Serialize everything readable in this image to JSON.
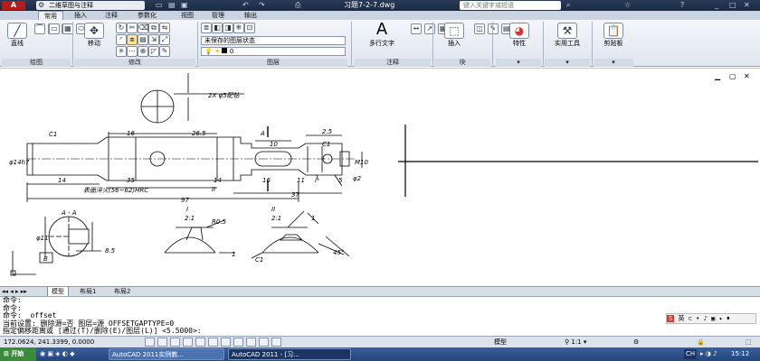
{
  "titlebar": {
    "workspace": "二维草图与注释",
    "title": "习题7-2-7.dwg",
    "search_placeholder": "键入关键字或短语"
  },
  "ribbon_tabs": [
    "常用",
    "插入",
    "注释",
    "参数化",
    "视图",
    "管理",
    "输出"
  ],
  "ribbon": {
    "groups": {
      "draw": "绘图",
      "modify": "修改",
      "layers": "图层",
      "annotation": "注释",
      "block": "块"
    },
    "buttons": {
      "line": "直线",
      "move": "移动",
      "mtext": "多行文字",
      "insert": "插入",
      "properties": "特性",
      "utilities": "实用工具",
      "clipboard": "剪贴板"
    },
    "layer_state": "未保存的图层状态",
    "layer_current": "0"
  },
  "drawing_tabs": [
    "模型",
    "布局1",
    "布局2"
  ],
  "command": {
    "lines": [
      "命令:",
      "命令:  _offset",
      "当前设置: 删除源=否  图层=源  OFFSETGAPTYPE=0",
      "指定偏移距离或 [通过(T)/删除(E)/图层(L)] <5.5000>:"
    ]
  },
  "status": {
    "coords": "172.0624, 241.3399, 0.0000",
    "model_label": "模型",
    "scale": "1:1"
  },
  "taskbar": {
    "start": "开始",
    "tasks": [
      "AutoCAD 2011实例教...",
      "AutoCAD 2011 - [习..."
    ],
    "ime": "CH",
    "time": "15:12"
  },
  "drawing": {
    "section_A": "A - A",
    "dim_97": "97",
    "dim_37": "37",
    "dim_35": "35",
    "dim_26_5": "26.5",
    "dim_16a": "16",
    "dim_16b": "16",
    "dim_14a": "14",
    "dim_14b": "14",
    "dim_10": "10",
    "dim_11": "11",
    "dim_2_5": "2.5",
    "dim_5": "5",
    "dim_C1a": "C1",
    "dim_C1b": "C1",
    "dim_C1c": "C1",
    "dim_phi2": "φ2",
    "dim_8_5": "8.5",
    "dim_R0_5": "R0.5",
    "dim_45": "45°",
    "note_holes": "2X φ5配钻",
    "note_hardness": "表面淬火(56~62)HRC",
    "label_A": "A",
    "label_B": "B",
    "label_I": "I",
    "label_II": "II",
    "scale_I": "2:1",
    "scale_II": "2:1",
    "dim_M10": "M10",
    "dim_phi14": "φ14h7",
    "dim_phi11": "φ11",
    "dim_1": "1",
    "dim_1b": "1"
  }
}
